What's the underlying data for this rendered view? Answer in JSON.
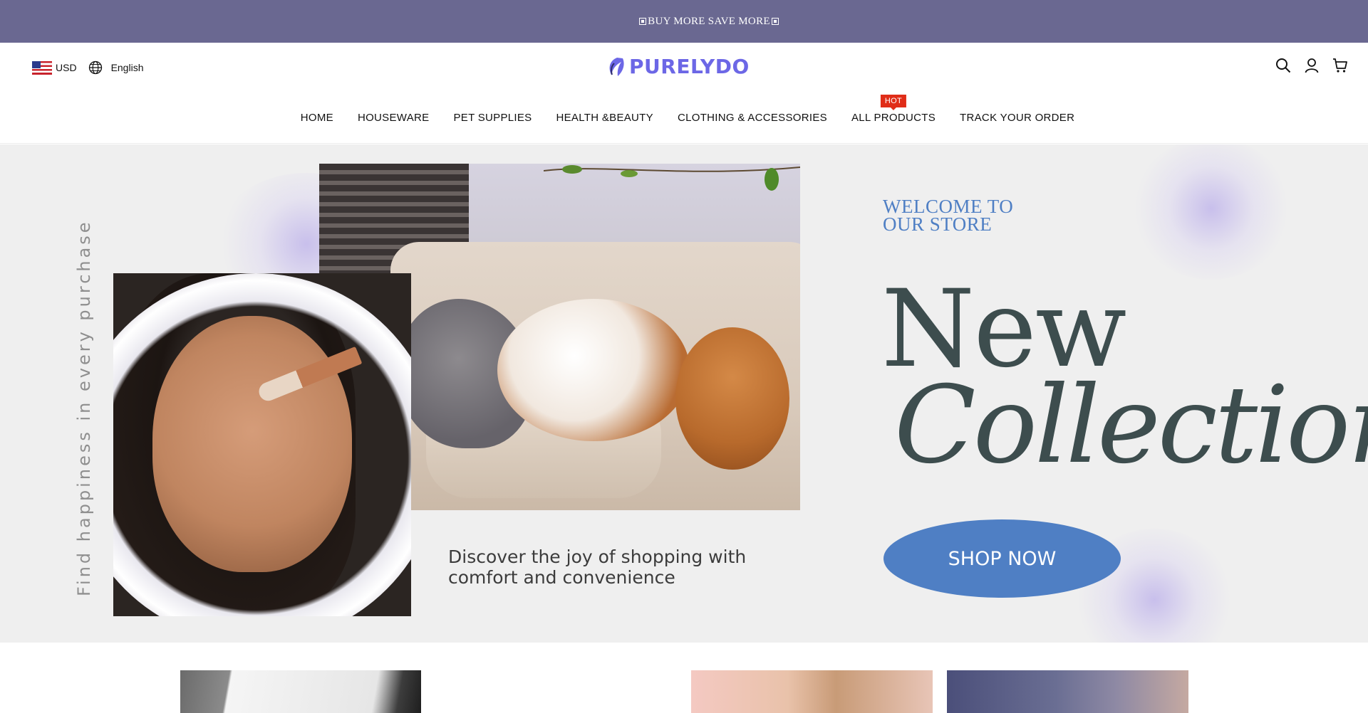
{
  "announcement": {
    "text": "BUY MORE SAVE MORE"
  },
  "header": {
    "currency": "USD",
    "language": "English",
    "logo_text": "PURELYDO"
  },
  "nav": {
    "items": [
      {
        "label": "HOME"
      },
      {
        "label": "HOUSEWARE"
      },
      {
        "label": "PET SUPPLIES"
      },
      {
        "label": "HEALTH &BEAUTY"
      },
      {
        "label": "CLOTHING & ACCESSORIES"
      },
      {
        "label": "ALL PRODUCTS",
        "badge": "HOT"
      },
      {
        "label": "TRACK YOUR ORDER"
      }
    ]
  },
  "hero": {
    "vertical_text": "Find happiness in every purchase",
    "welcome_line1": "WELCOME TO",
    "welcome_line2": "OUR STORE",
    "headline_line1": "New",
    "headline_line2": "Collection",
    "tagline": "Discover the joy of shopping with comfort and convenience",
    "cta_label": "SHOP NOW"
  },
  "icons": {
    "search": "search-icon",
    "account": "user-icon",
    "cart": "cart-icon",
    "language": "globe-icon",
    "currency_flag": "us-flag-icon"
  },
  "colors": {
    "announcement_bg": "#6a6891",
    "logo": "#6c67e6",
    "accent_blue": "#4f7fc4",
    "headline": "#3d4d4e",
    "hot_badge": "#e02d18",
    "hero_bg": "#efefef"
  }
}
